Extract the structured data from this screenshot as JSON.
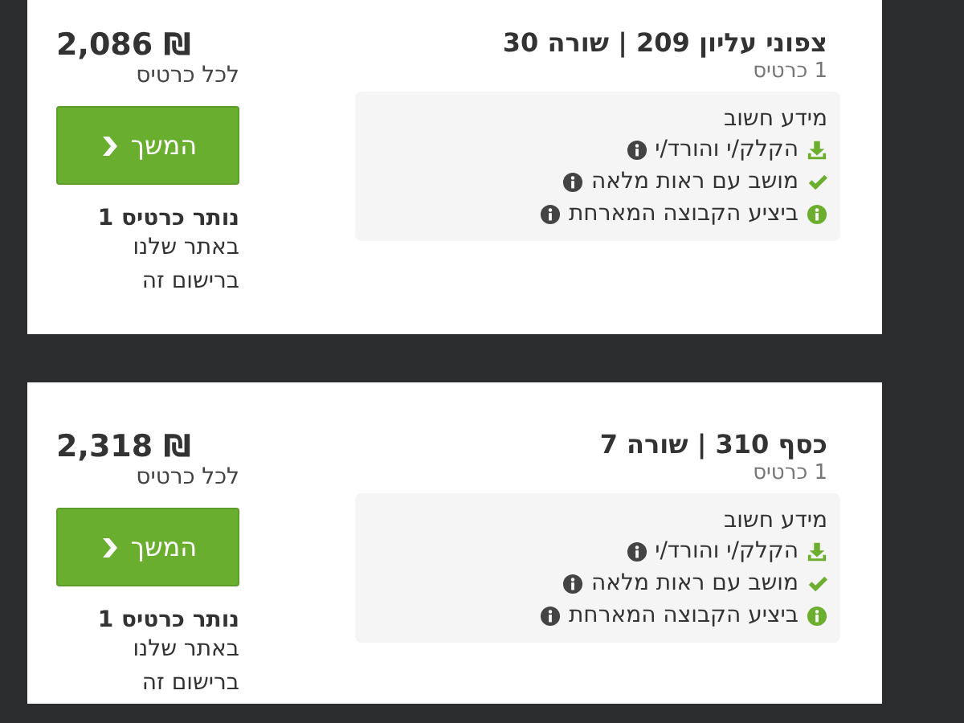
{
  "listings": [
    {
      "title": "צפוני עליון 209 | שורה 30",
      "quantity": "1 כרטיס",
      "info_heading": "מידע חשוב",
      "features": [
        {
          "kind": "download",
          "text": "הקלק/י והורד/י",
          "info": true
        },
        {
          "kind": "check",
          "text": "מושב עם ראות מלאה",
          "info": true
        },
        {
          "kind": "info",
          "text": "ביציע הקבוצה המארחת",
          "info": true
        }
      ],
      "price": "2,086 ₪",
      "price_note": "לכל כרטיס",
      "button": "המשך",
      "remaining": "נותר כרטיס 1",
      "remaining_note": "באתר שלנו\nברישום זה"
    },
    {
      "title": "כסף 310 | שורה 7",
      "quantity": "1 כרטיס",
      "info_heading": "מידע חשוב",
      "features": [
        {
          "kind": "download",
          "text": "הקלק/י והורד/י",
          "info": true
        },
        {
          "kind": "check",
          "text": "מושב עם ראות מלאה",
          "info": true
        },
        {
          "kind": "info",
          "text": "ביציע הקבוצה המארחת",
          "info": true
        }
      ],
      "price": "2,318 ₪",
      "price_note": "לכל כרטיס",
      "button": "המשך",
      "remaining": "נותר כרטיס 1",
      "remaining_note": "באתר שלנו\nברישום זה"
    }
  ]
}
